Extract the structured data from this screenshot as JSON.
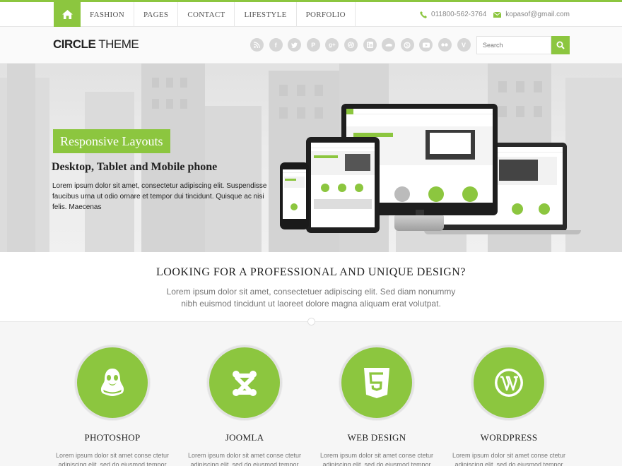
{
  "nav": {
    "home_icon": "home-icon",
    "items": [
      "FASHION",
      "PAGES",
      "CONTACT",
      "LIFESTYLE",
      "PORFOLIO"
    ]
  },
  "contact": {
    "phone": "011800-562-3764",
    "email": "kopasof@gmail.com"
  },
  "brand": {
    "logo_bold": "CIRCLE",
    "logo_light": " THEME",
    "accent_color": "#8cc63f"
  },
  "social_icons": [
    "rss-icon",
    "facebook-icon",
    "twitter-icon",
    "pinterest-icon",
    "google-plus-icon",
    "dribbble-icon",
    "linkedin-icon",
    "flickr-icon",
    "skype-icon",
    "youtube-icon",
    "flickr-dots-icon",
    "vimeo-icon"
  ],
  "search": {
    "placeholder": "Search"
  },
  "hero": {
    "badge": "Responsive Layouts",
    "title": "Desktop, Tablet and Mobile phone",
    "text": "Lorem ipsum dolor sit amet, consectetur adipiscing elit. Suspendisse faucibus urna ut odio ornare et tempor dui tincidunt. Quisque ac nisi felis. Maecenas"
  },
  "intro": {
    "heading": "LOOKING FOR A PROFESSIONAL AND UNIQUE DESIGN?",
    "text": "Lorem ipsum dolor sit amet, consectetuer adipiscing elit. Sed diam nonummy nibh euismod tincidunt ut laoreet dolore magna aliquam erat volutpat."
  },
  "features": [
    {
      "title": "PHOTOSHOP",
      "icon": "linux-penguin-icon",
      "text": "Lorem ipsum dolor sit amet conse ctetur adipiscing elit, sed do eiusmod tempor"
    },
    {
      "title": "JOOMLA",
      "icon": "joomla-icon",
      "text": "Lorem ipsum dolor sit amet conse ctetur adipiscing elit, sed do eiusmod tempor"
    },
    {
      "title": "WEB DESIGN",
      "icon": "html5-icon",
      "text": "Lorem ipsum dolor sit amet conse ctetur adipiscing elit, sed do eiusmod tempor"
    },
    {
      "title": "WORDPRESS",
      "icon": "wordpress-icon",
      "text": "Lorem ipsum dolor sit amet conse ctetur adipiscing elit, sed do eiusmod tempor"
    }
  ]
}
